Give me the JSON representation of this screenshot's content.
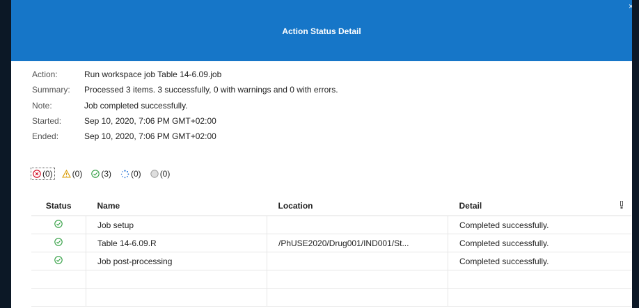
{
  "dialog": {
    "title": "Action Status Detail",
    "close_label": "×"
  },
  "info": {
    "action_label": "Action:",
    "action_value": "Run workspace job Table 14-6.09.job",
    "summary_label": "Summary:",
    "summary_value": "Processed 3 items.  3 successfully, 0 with warnings and 0 with errors.",
    "note_label": "Note:",
    "note_value": "Job completed successfully.",
    "started_label": "Started:",
    "started_value": "Sep 10, 2020, 7:06 PM GMT+02:00",
    "ended_label": "Ended:",
    "ended_value": "Sep 10, 2020, 7:06 PM GMT+02:00"
  },
  "filters": {
    "error": "(0)",
    "warning": "(0)",
    "success": "(3)",
    "running": "(0)",
    "other": "(0)"
  },
  "table": {
    "headers": {
      "status": "Status",
      "name": "Name",
      "location": "Location",
      "detail": "Detail"
    },
    "rows": [
      {
        "name": "Job setup",
        "location": "",
        "detail": "Completed successfully."
      },
      {
        "name": "Table 14-6.09.R",
        "location": "/PhUSE2020/Drug001/IND001/St...",
        "detail": "Completed successfully."
      },
      {
        "name": "Job post-processing",
        "location": "",
        "detail": "Completed successfully."
      }
    ]
  },
  "colors": {
    "titlebar": "#1676c8",
    "success": "#2e9d3f",
    "error": "#d0021b",
    "warning": "#d99a00",
    "running": "#1f6fd6"
  },
  "icons": {
    "success": "check-circle-icon",
    "error": "x-circle-icon",
    "warning": "warning-triangle-icon",
    "running": "spinner-icon",
    "other": "gray-circle-icon",
    "column_menu": "column-menu-icon"
  }
}
